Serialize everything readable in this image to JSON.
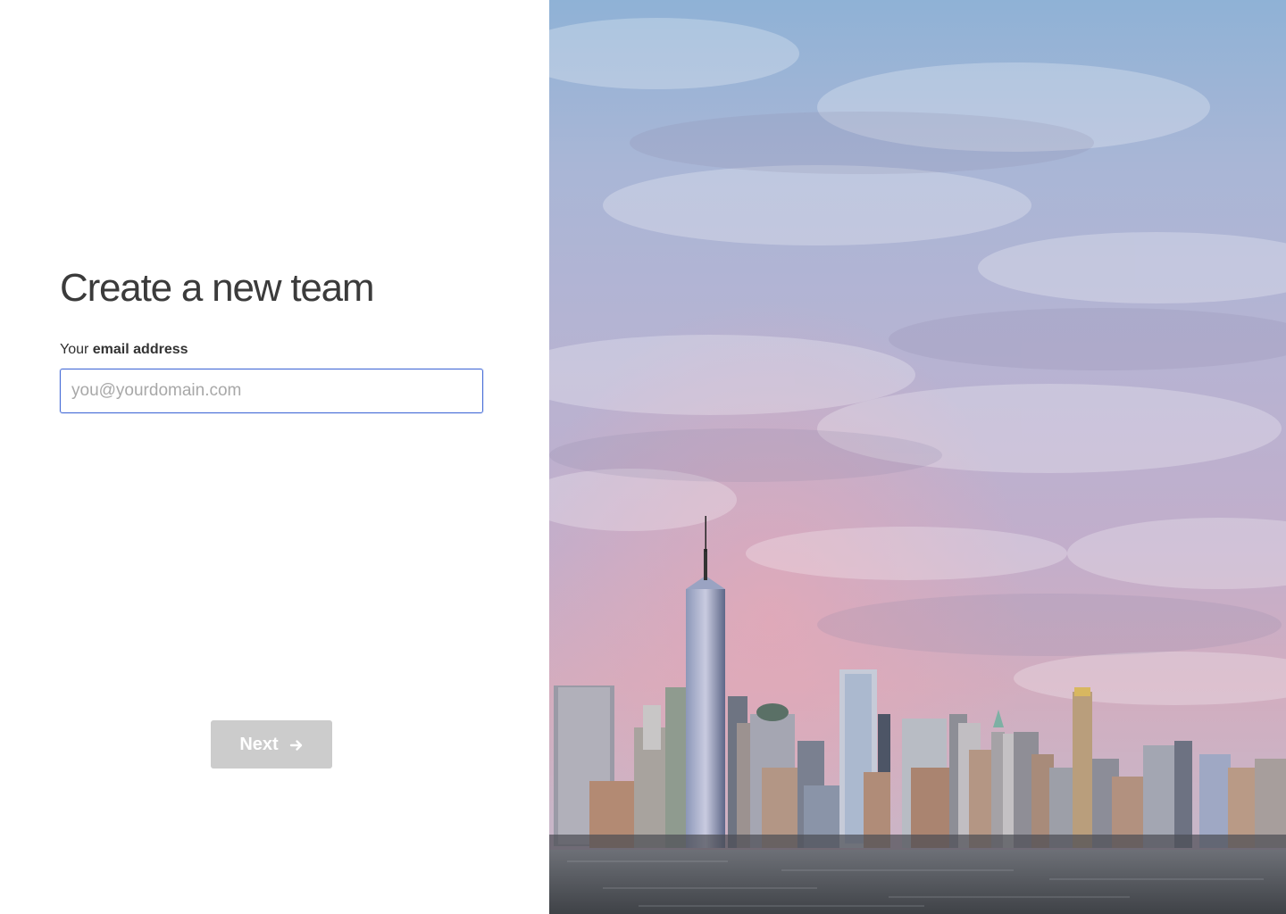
{
  "form": {
    "title": "Create a new team",
    "label_prefix": "Your",
    "label_bold": "email address",
    "email_value": "",
    "email_placeholder": "you@yourdomain.com",
    "next_label": "Next",
    "next_icon": "arrow-right-icon"
  },
  "hero": {
    "image_name": "city-skyline-image"
  },
  "colors": {
    "input_focus_border": "#4a6fd8",
    "button_disabled_bg": "#cccccc",
    "button_text": "#ffffff",
    "title_text": "#3b3b3b"
  }
}
